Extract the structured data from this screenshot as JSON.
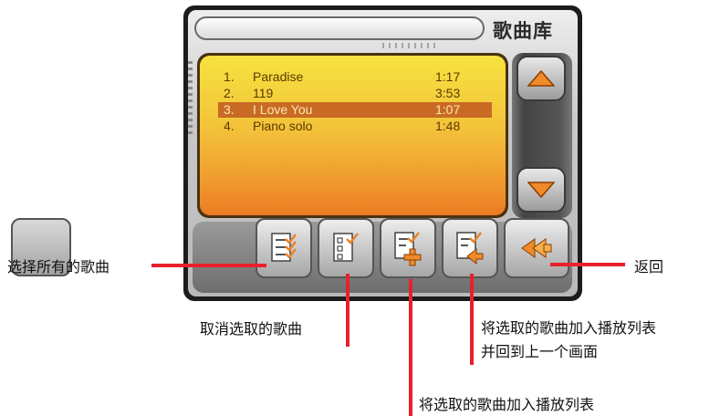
{
  "header": {
    "title": "歌曲库"
  },
  "song_list": [
    {
      "index": "1.",
      "name": "Paradise",
      "duration": "1:17",
      "selected": false
    },
    {
      "index": "2.",
      "name": "119",
      "duration": "3:53",
      "selected": false
    },
    {
      "index": "3.",
      "name": "I Love You",
      "duration": "1:07",
      "selected": true
    },
    {
      "index": "4.",
      "name": "Piano solo",
      "duration": "1:48",
      "selected": false
    }
  ],
  "callouts": {
    "select_all": "选择所有的歌曲",
    "deselect": "取消选取的歌曲",
    "add_to_playlist": "将选取的歌曲加入播放列表",
    "add_and_return_line1": "将选取的歌曲加入播放列表",
    "add_and_return_line2": "并回到上一个画面",
    "back": "返回"
  },
  "icons": {
    "scroll_up": "arrow-up-icon",
    "scroll_down": "arrow-down-icon",
    "select_all": "checklist-all-icon",
    "deselect": "checklist-one-icon",
    "add": "checklist-add-icon",
    "add_return": "checklist-return-icon",
    "back": "double-arrow-left-icon"
  },
  "colors": {
    "accent_orange": "#f08a2a",
    "callout_red": "#e8202a",
    "selection": "#c96a24"
  }
}
